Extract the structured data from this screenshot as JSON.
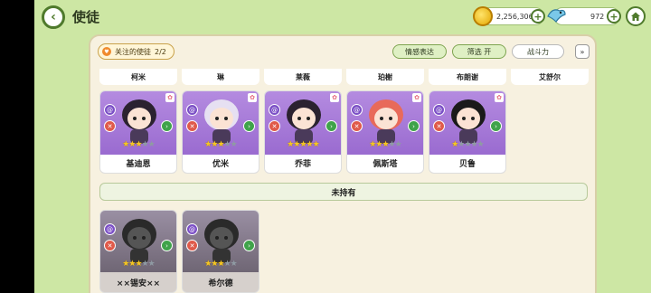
{
  "header": {
    "back_icon": "chevron-left-icon",
    "title": "使徒",
    "coins": "2,256,306",
    "gems": "972"
  },
  "filters": {
    "followed_label": "关注的使徒",
    "followed_count": "2/2",
    "emotion_label": "情感表达",
    "filter_label": "筛选 开",
    "power_label": "战斗力"
  },
  "top_names": [
    "柯米",
    "琳",
    "莱薇",
    "珀榭",
    "布朗谢",
    "艾舒尔"
  ],
  "owned_cards": [
    {
      "name": "基迪恩",
      "stars": 3
    },
    {
      "name": "优米",
      "stars": 3
    },
    {
      "name": "乔菲",
      "stars": 5
    },
    {
      "name": "佩斯塔",
      "stars": 3
    },
    {
      "name": "贝鲁",
      "stars": 1
    }
  ],
  "unowned_label": "未持有",
  "unowned_cards": [
    {
      "name": "××锡安××",
      "stars": 3
    },
    {
      "name": "希尔德",
      "stars": 3
    }
  ],
  "colors": {
    "background": "#cde7a4",
    "accent": "#4f7a2c",
    "card_portrait": "#b48be0"
  }
}
